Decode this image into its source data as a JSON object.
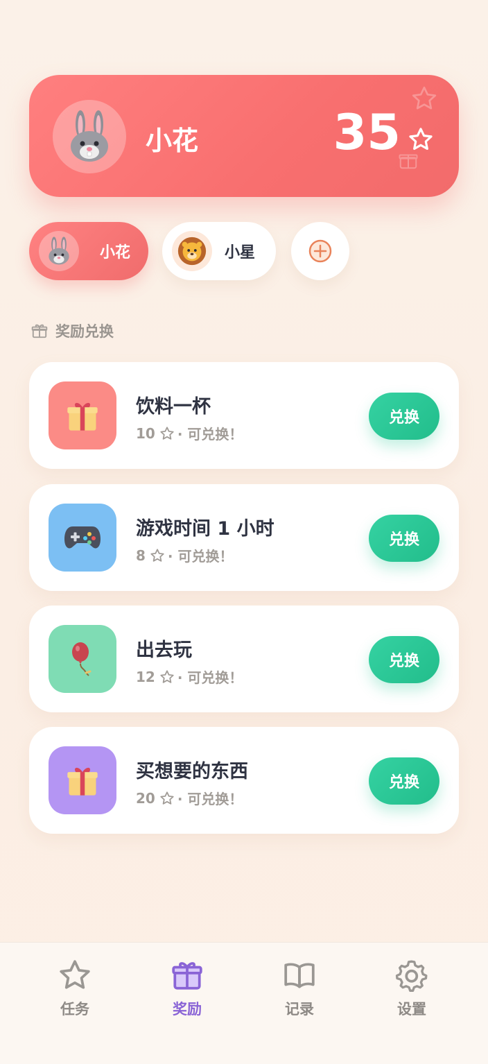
{
  "profile": {
    "name": "小花",
    "points": "35",
    "avatar_icon": "rabbit-icon"
  },
  "kids": [
    {
      "name": "小花",
      "avatar_icon": "rabbit-icon",
      "active": true
    },
    {
      "name": "小星",
      "avatar_icon": "lion-icon",
      "active": false
    }
  ],
  "add_kid_icon": "plus-circle-icon",
  "section": {
    "title": "奖励兑换",
    "icon": "gift-outline-icon"
  },
  "rewards": [
    {
      "title": "饮料一杯",
      "cost": "10",
      "status": "· 可兑换！",
      "button": "兑换",
      "icon": "gift-icon",
      "tile_color": "#fb8b86"
    },
    {
      "title": "游戏时间 1 小时",
      "cost": "8",
      "status": "· 可兑换！",
      "button": "兑换",
      "icon": "gamepad-icon",
      "tile_color": "#7cbff3"
    },
    {
      "title": "出去玩",
      "cost": "12",
      "status": "· 可兑换！",
      "button": "兑换",
      "icon": "balloon-icon",
      "tile_color": "#7fdcb4"
    },
    {
      "title": "买想要的东西",
      "cost": "20",
      "status": "· 可兑换！",
      "button": "兑换",
      "icon": "gift-icon",
      "tile_color": "#b495f3"
    }
  ],
  "tabs": [
    {
      "label": "任务",
      "icon": "star-icon",
      "active": false
    },
    {
      "label": "奖励",
      "icon": "gift-icon",
      "active": true
    },
    {
      "label": "记录",
      "icon": "book-icon",
      "active": false
    },
    {
      "label": "设置",
      "icon": "gear-icon",
      "active": false
    }
  ],
  "colors": {
    "hero": "#f87171",
    "accent_green": "#27c192",
    "active_tab": "#8a64d6"
  }
}
